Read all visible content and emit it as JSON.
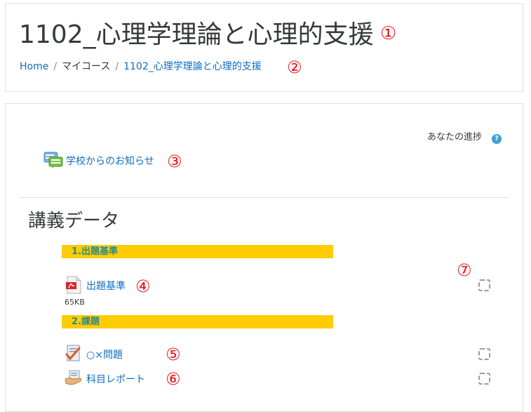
{
  "header": {
    "title": "1102_心理学理論と心理的支援",
    "title_marker": "①",
    "breadcrumb": {
      "home": "Home",
      "sep1": "/",
      "my_courses": "マイコース",
      "sep2": "/",
      "course": "1102_心理学理論と心理的支援"
    },
    "breadcrumb_marker": "②"
  },
  "progress": {
    "label": "あなたの進捗",
    "help_icon": "?"
  },
  "announcements": {
    "label": "学校からのお知らせ",
    "marker": "③"
  },
  "section": {
    "title": "講義データ",
    "labels": [
      "1.出題基準",
      "2.課題"
    ],
    "completion_marker": "⑦"
  },
  "activities": [
    {
      "label": "出題基準",
      "marker": "④",
      "filesize": "65KB",
      "icon": "pdf-icon"
    },
    {
      "label": "○×問題",
      "marker": "⑤",
      "icon": "quiz-icon"
    },
    {
      "label": "科目レポート",
      "marker": "⑥",
      "icon": "assignment-icon"
    }
  ],
  "colors": {
    "link": "#0f6cbf",
    "marker": "#e8161a",
    "label_bar": "#ffcc00",
    "label_text": "#2e8b8b",
    "help_icon": "#3fa0d5"
  }
}
